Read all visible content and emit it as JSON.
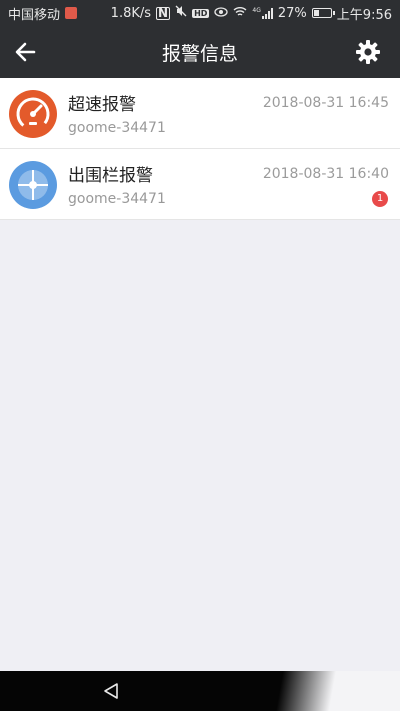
{
  "status_bar": {
    "carrier": "中国移动",
    "speed": "1.8K/s",
    "network": "4G",
    "battery": "27%",
    "time": "上午9:56"
  },
  "header": {
    "title": "报警信息",
    "back_icon": "arrow-left-icon",
    "settings_icon": "gear-icon"
  },
  "alarms": [
    {
      "type": "超速报警",
      "device": "goome-34471",
      "time": "2018-08-31 16:45",
      "icon": "speedometer-icon",
      "icon_color": "#e35a2b"
    },
    {
      "type": "出围栏报警",
      "device": "goome-34471",
      "time": "2018-08-31 16:40",
      "icon": "geofence-icon",
      "icon_color": "#5b9be0",
      "badge": "1"
    }
  ],
  "colors": {
    "header_bg": "#2d2f32",
    "page_bg": "#efeff4",
    "badge": "#e84a4a"
  }
}
